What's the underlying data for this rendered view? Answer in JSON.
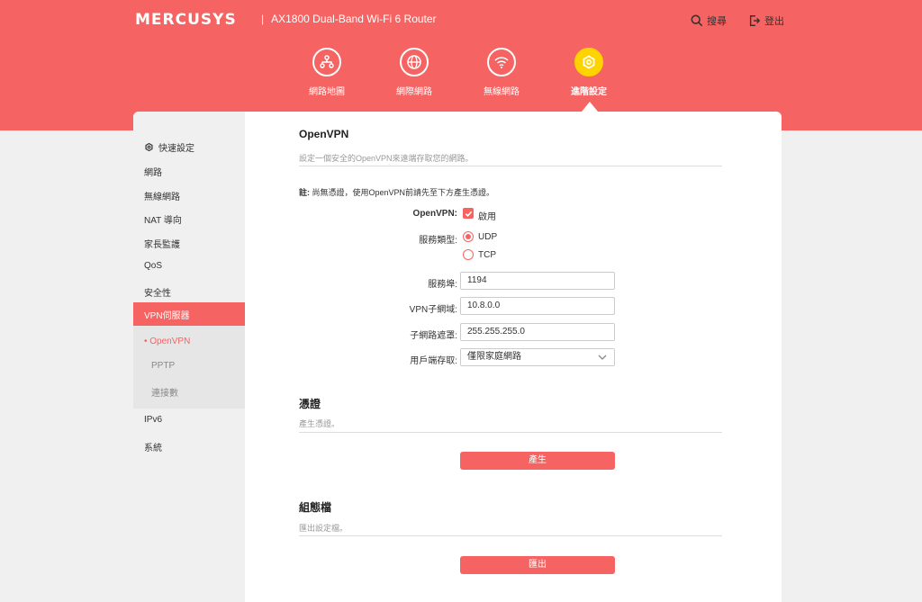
{
  "header": {
    "brand": "MERCUSYS",
    "separator": "|",
    "model": "AX1800 Dual-Band Wi-Fi 6 Router",
    "search_label": "搜尋",
    "logout_label": "登出"
  },
  "nav_tabs": [
    {
      "label": "網路地圖",
      "icon": "network-map-icon"
    },
    {
      "label": "網際網路",
      "icon": "globe-icon"
    },
    {
      "label": "無線網路",
      "icon": "wifi-icon"
    },
    {
      "label": "進階設定",
      "icon": "gear-icon",
      "active": true
    }
  ],
  "sidebar": {
    "items": [
      "快速設定",
      "網路",
      "無線網路",
      "NAT 導向",
      "家長監護",
      "QoS",
      "安全性",
      "VPN伺服器",
      "IPv6",
      "系統"
    ],
    "active": "VPN伺服器",
    "sub_items": [
      "OpenVPN",
      "PPTP",
      "連接數"
    ],
    "active_sub": "OpenVPN"
  },
  "openvpn": {
    "title": "OpenVPN",
    "description": "設定一個安全的OpenVPN來遠端存取您的網路。",
    "note_prefix": "註:",
    "note_text": "尚無憑證，使用OpenVPN前請先至下方產生憑證。",
    "enable_label": "OpenVPN:",
    "enable_option": "啟用",
    "enabled": true,
    "service_type_label": "服務類型:",
    "service_type_options": [
      "UDP",
      "TCP"
    ],
    "service_type_selected": "UDP",
    "port_label": "服務埠:",
    "port_value": "1194",
    "subnet_label": "VPN子網域:",
    "subnet_value": "10.8.0.0",
    "netmask_label": "子網路遮罩:",
    "netmask_value": "255.255.255.0",
    "client_access_label": "用戶端存取:",
    "client_access_value": "僅限家庭網路"
  },
  "certificate": {
    "title": "憑證",
    "description": "產生憑證。",
    "button_label": "產生"
  },
  "config_file": {
    "title": "組態檔",
    "description": "匯出設定檔。",
    "button_label": "匯出"
  },
  "colors": {
    "brand_red": "#f56462",
    "active_yellow": "#ffd300"
  }
}
